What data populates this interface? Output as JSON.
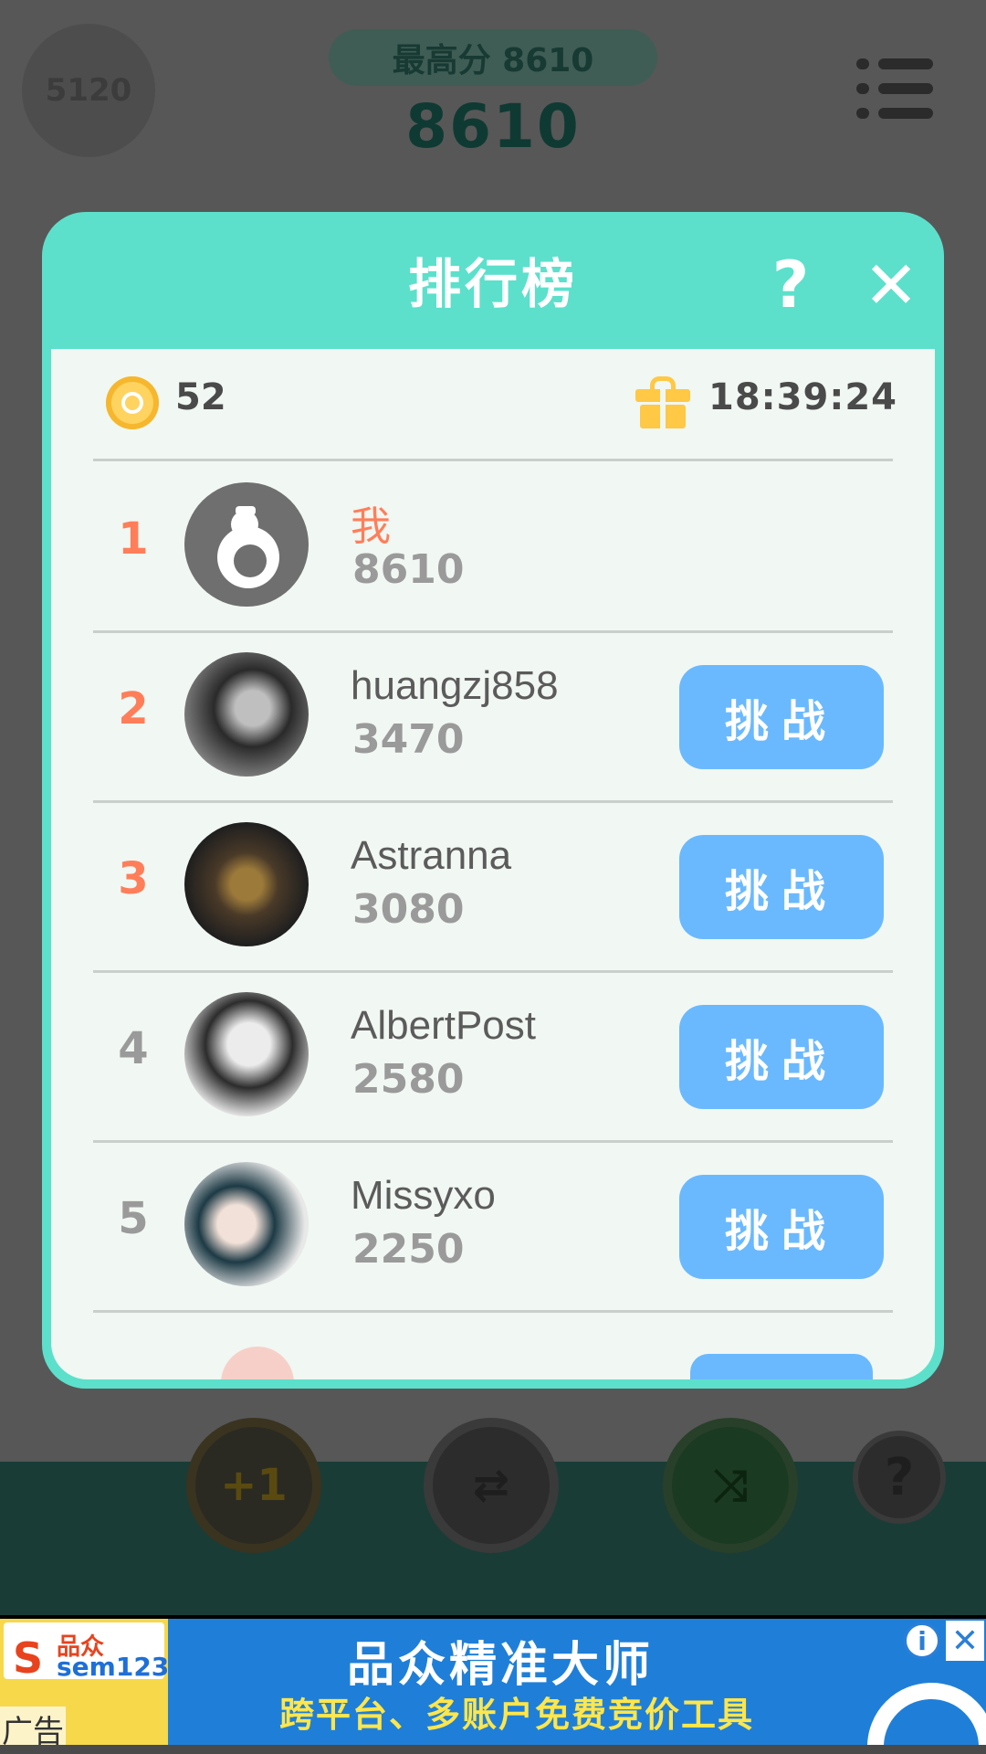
{
  "game": {
    "level_badge": "5120",
    "best_score_label": "最高分 8610",
    "current_score": "8610"
  },
  "leaderboard": {
    "title": "排行榜",
    "help_glyph": "?",
    "close_glyph": "✕",
    "coins": "52",
    "countdown": "18:39:24",
    "challenge_label": "挑战",
    "entries": [
      {
        "rank": "1",
        "name": "我",
        "score": "8610"
      },
      {
        "rank": "2",
        "name": "huangzj858",
        "score": "3470"
      },
      {
        "rank": "3",
        "name": "Astranna",
        "score": "3080"
      },
      {
        "rank": "4",
        "name": "AlbertPost",
        "score": "2580"
      },
      {
        "rank": "5",
        "name": "Missyxo",
        "score": "2250"
      }
    ]
  },
  "tools": {
    "plus_one": "+1",
    "swap_glyph": "⇄",
    "shuffle_glyph": "⤨",
    "help_glyph": "?"
  },
  "ad": {
    "logo_brand": "品众",
    "logo_tag": "sem123",
    "headline": "品众精准大师",
    "subline": "跨平台、多账户免费竞价工具",
    "ad_label": "广告",
    "info_glyph": "i",
    "close_glyph": "✕"
  },
  "colors": {
    "modal": "#5ce0cb",
    "challenge_button": "#6ab9ff",
    "rank_accent": "#ff7e5a"
  }
}
